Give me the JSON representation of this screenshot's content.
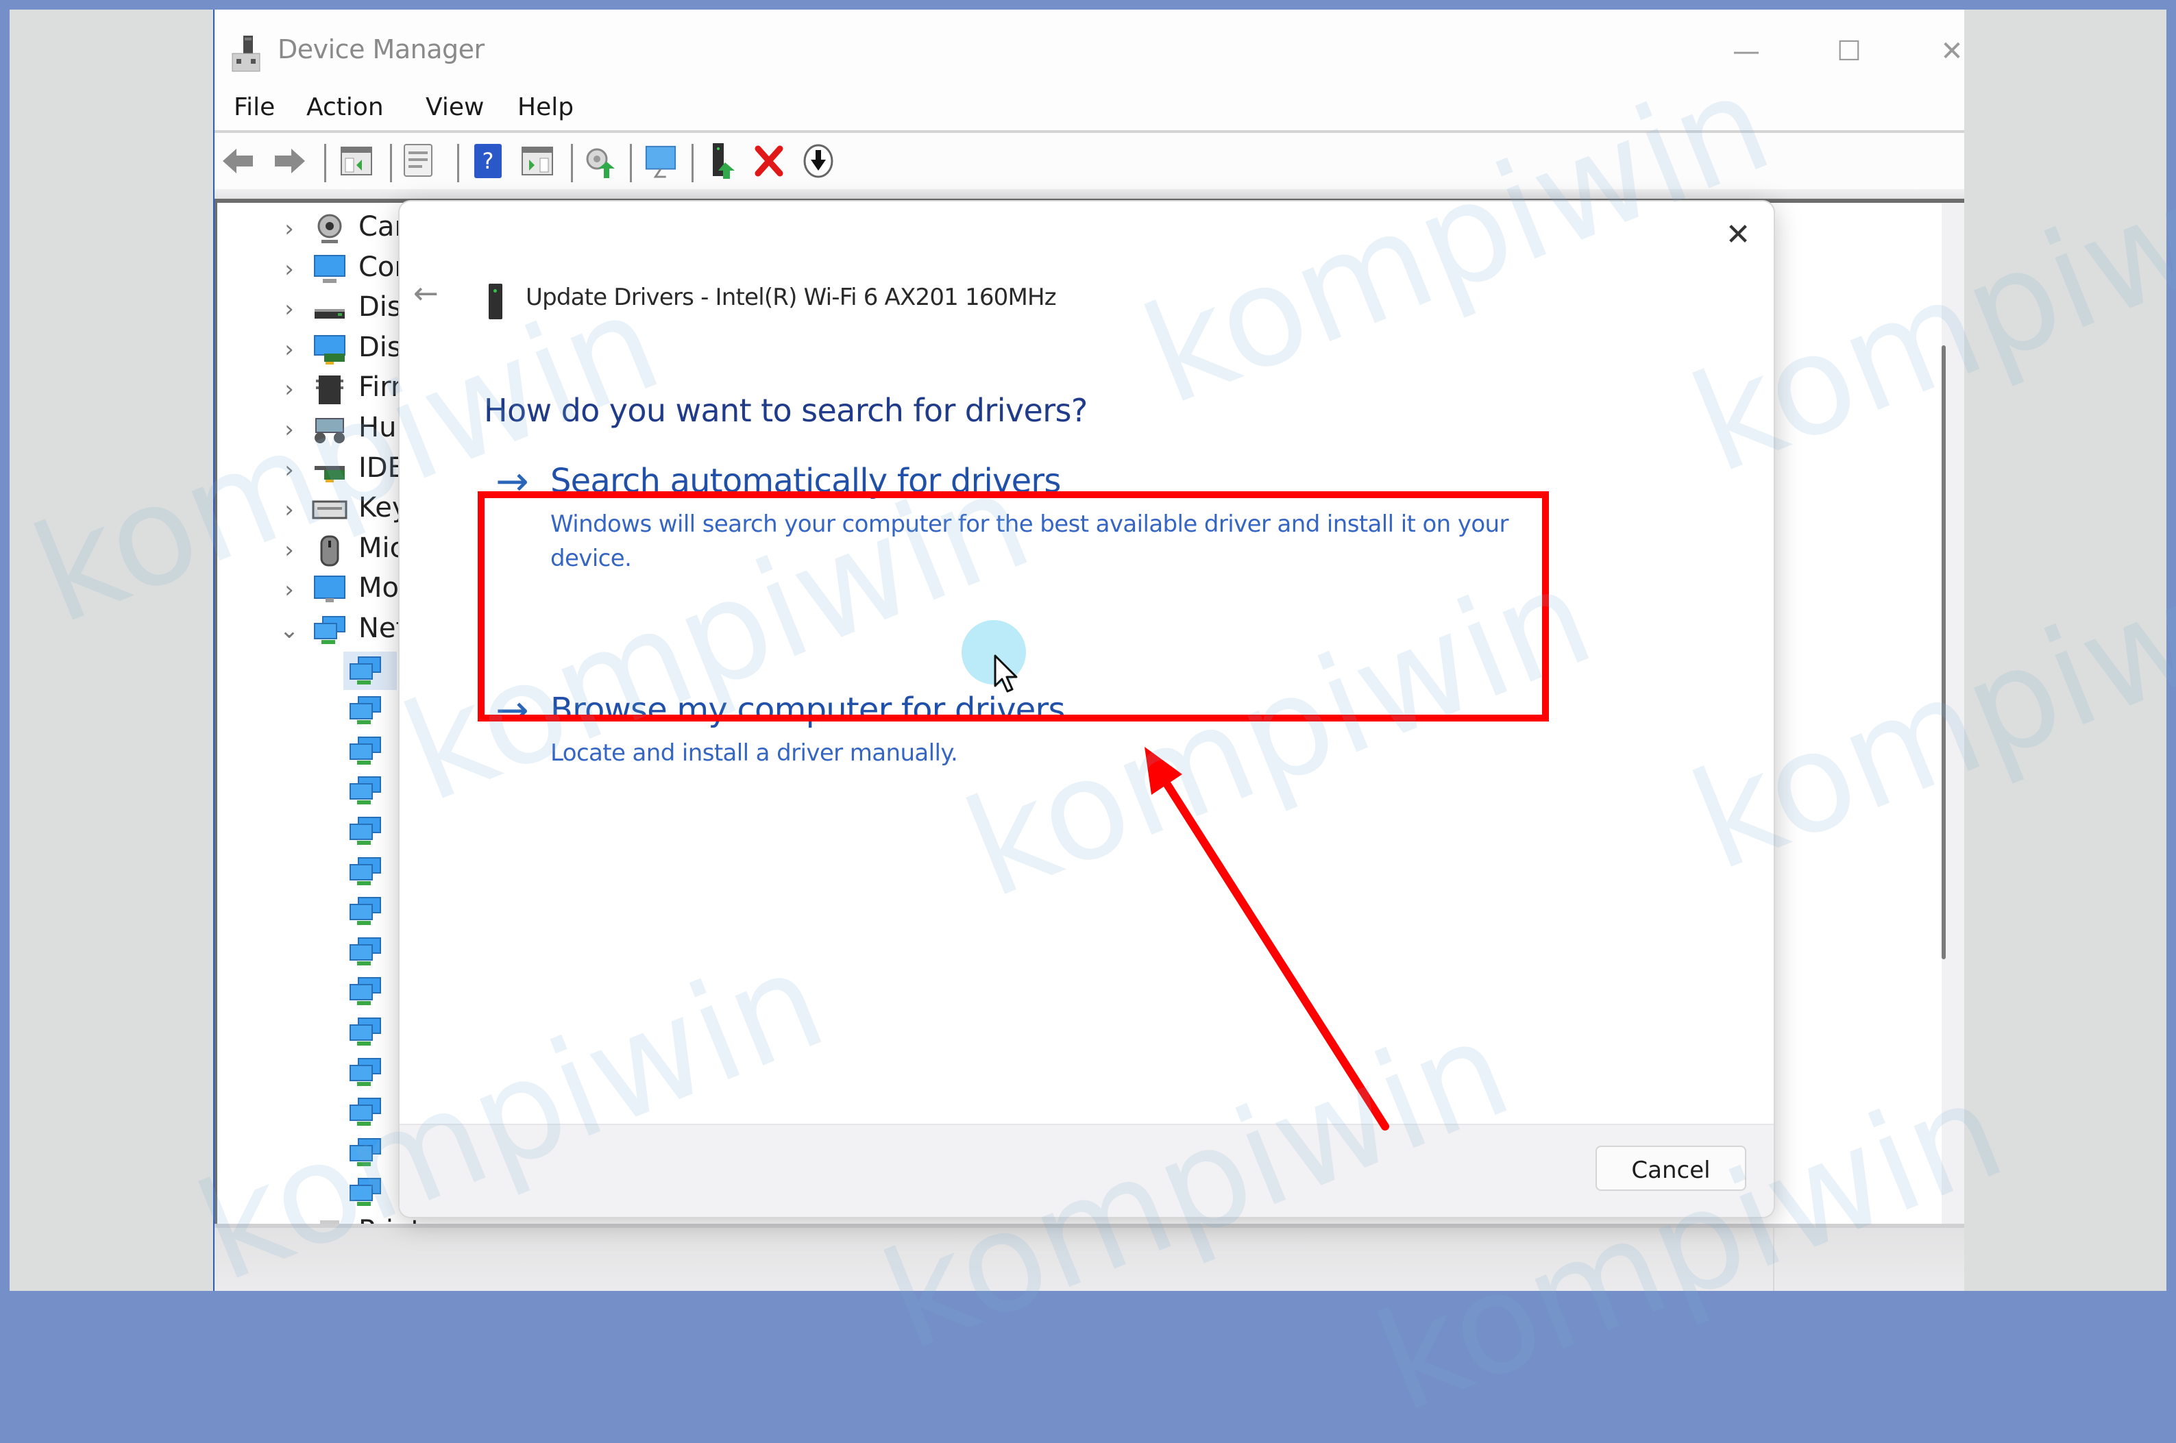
{
  "window": {
    "title": "Device Manager",
    "controls": {
      "minimize": "—",
      "maximize": "☐",
      "close": "✕"
    }
  },
  "menu": {
    "items": [
      {
        "label": "File"
      },
      {
        "label": "Action"
      },
      {
        "label": "View"
      },
      {
        "label": "Help"
      }
    ]
  },
  "toolbar": {
    "buttons": [
      {
        "icon": "back-arrow-icon"
      },
      {
        "icon": "forward-arrow-icon"
      },
      {
        "icon": "show-hide-console-tree-icon"
      },
      {
        "icon": "properties-icon"
      },
      {
        "icon": "help-icon"
      },
      {
        "icon": "show-action-pane-icon"
      },
      {
        "icon": "scan-hardware-changes-icon"
      },
      {
        "icon": "monitor-icon"
      },
      {
        "icon": "update-driver-icon"
      },
      {
        "icon": "uninstall-device-icon"
      },
      {
        "icon": "download-icon"
      }
    ]
  },
  "tree": {
    "categories": [
      {
        "label": "Car",
        "icon": "camera-icon",
        "expanded": false
      },
      {
        "label": "Cor",
        "icon": "computer-icon",
        "expanded": false
      },
      {
        "label": "Disl",
        "icon": "disk-drive-icon",
        "expanded": false
      },
      {
        "label": "Disp",
        "icon": "display-adapter-icon",
        "expanded": false
      },
      {
        "label": "Firn",
        "icon": "firmware-icon",
        "expanded": false
      },
      {
        "label": "Hur",
        "icon": "hid-icon",
        "expanded": false
      },
      {
        "label": "IDE",
        "icon": "ide-controller-icon",
        "expanded": false
      },
      {
        "label": "Key",
        "icon": "keyboard-icon",
        "expanded": false
      },
      {
        "label": "Mic",
        "icon": "mouse-icon",
        "expanded": false
      },
      {
        "label": "Mo",
        "icon": "monitor-icon",
        "expanded": false
      },
      {
        "label": "Net",
        "icon": "network-adapter-icon",
        "expanded": true
      }
    ],
    "network_children_count": 14,
    "last_visible": {
      "label": "Print queues",
      "icon": "printer-icon"
    }
  },
  "dialog": {
    "title": "Update Drivers - Intel(R) Wi-Fi 6 AX201 160MHz",
    "heading": "How do you want to search for drivers?",
    "options": [
      {
        "arrow": "→",
        "title": "Search automatically for drivers",
        "description": "Windows will search your computer for the best available driver and install it on your device."
      },
      {
        "arrow": "→",
        "title": "Browse my computer for drivers",
        "description": "Locate and install a driver manually."
      }
    ],
    "close": "✕",
    "back": "←",
    "cancel_label": "Cancel"
  },
  "annotation": {
    "highlight_color": "#ff0000",
    "highlighted_option": "Search automatically for drivers"
  },
  "watermark": {
    "text": "kompiwin"
  },
  "colors": {
    "frame": "#7590c8",
    "link_blue": "#2050a8",
    "heading_blue": "#1f3b8a"
  }
}
